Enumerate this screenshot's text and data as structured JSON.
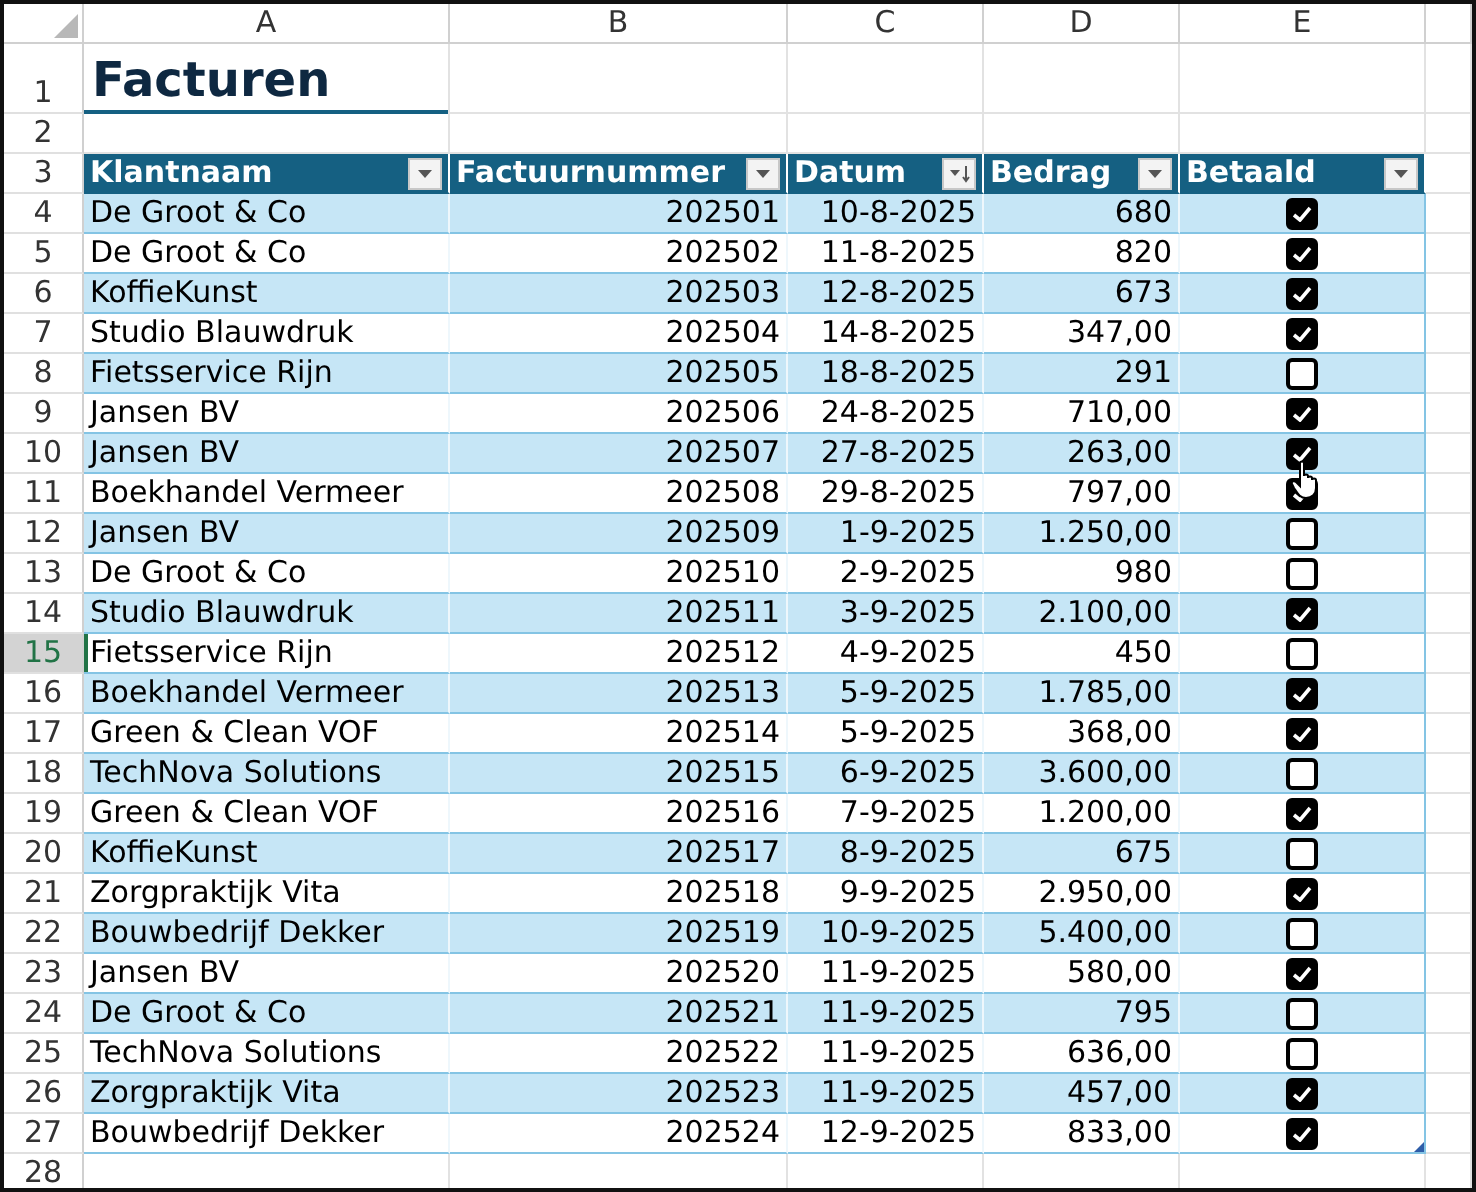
{
  "column_headers": [
    {
      "label": "A",
      "selected": false
    },
    {
      "label": "B",
      "selected": false
    },
    {
      "label": "C",
      "selected": false
    },
    {
      "label": "D",
      "selected": false
    },
    {
      "label": "E",
      "selected": false
    }
  ],
  "row_numbers": [
    {
      "label": "1",
      "selected": false
    },
    {
      "label": "2",
      "selected": false
    },
    {
      "label": "3",
      "selected": false
    },
    {
      "label": "4",
      "selected": false
    },
    {
      "label": "5",
      "selected": false
    },
    {
      "label": "6",
      "selected": false
    },
    {
      "label": "7",
      "selected": false
    },
    {
      "label": "8",
      "selected": false
    },
    {
      "label": "9",
      "selected": false
    },
    {
      "label": "10",
      "selected": false
    },
    {
      "label": "11",
      "selected": false
    },
    {
      "label": "12",
      "selected": false
    },
    {
      "label": "13",
      "selected": false
    },
    {
      "label": "14",
      "selected": false
    },
    {
      "label": "15",
      "selected": true
    },
    {
      "label": "16",
      "selected": false
    },
    {
      "label": "17",
      "selected": false
    },
    {
      "label": "18",
      "selected": false
    },
    {
      "label": "19",
      "selected": false
    },
    {
      "label": "20",
      "selected": false
    },
    {
      "label": "21",
      "selected": false
    },
    {
      "label": "22",
      "selected": false
    },
    {
      "label": "23",
      "selected": false
    },
    {
      "label": "24",
      "selected": false
    },
    {
      "label": "25",
      "selected": false
    },
    {
      "label": "26",
      "selected": false
    },
    {
      "label": "27",
      "selected": false
    },
    {
      "label": "28",
      "selected": false
    }
  ],
  "title": "Facturen",
  "table": {
    "columns": [
      {
        "label": "Klantnaam",
        "sorted": false
      },
      {
        "label": "Factuurnummer",
        "sorted": false
      },
      {
        "label": "Datum",
        "sorted": true
      },
      {
        "label": "Bedrag",
        "sorted": false
      },
      {
        "label": "Betaald",
        "sorted": false
      }
    ],
    "rows": [
      {
        "client": "De Groot & Co",
        "number": "202501",
        "date": "10-8-2025",
        "amount": "680",
        "paid": true
      },
      {
        "client": "De Groot & Co",
        "number": "202502",
        "date": "11-8-2025",
        "amount": "820",
        "paid": true
      },
      {
        "client": "KoffieKunst",
        "number": "202503",
        "date": "12-8-2025",
        "amount": "673",
        "paid": true
      },
      {
        "client": "Studio Blauwdruk",
        "number": "202504",
        "date": "14-8-2025",
        "amount": "347,00",
        "paid": true
      },
      {
        "client": "Fietsservice Rijn",
        "number": "202505",
        "date": "18-8-2025",
        "amount": "291",
        "paid": false
      },
      {
        "client": "Jansen BV",
        "number": "202506",
        "date": "24-8-2025",
        "amount": "710,00",
        "paid": true
      },
      {
        "client": "Jansen BV",
        "number": "202507",
        "date": "27-8-2025",
        "amount": "263,00",
        "paid": true
      },
      {
        "client": "Boekhandel Vermeer",
        "number": "202508",
        "date": "29-8-2025",
        "amount": "797,00",
        "paid": true
      },
      {
        "client": "Jansen BV",
        "number": "202509",
        "date": "1-9-2025",
        "amount": "1.250,00",
        "paid": false
      },
      {
        "client": "De Groot & Co",
        "number": "202510",
        "date": "2-9-2025",
        "amount": "980",
        "paid": false
      },
      {
        "client": "Studio Blauwdruk",
        "number": "202511",
        "date": "3-9-2025",
        "amount": "2.100,00",
        "paid": true
      },
      {
        "client": "Fietsservice Rijn",
        "number": "202512",
        "date": "4-9-2025",
        "amount": "450",
        "paid": false
      },
      {
        "client": "Boekhandel Vermeer",
        "number": "202513",
        "date": "5-9-2025",
        "amount": "1.785,00",
        "paid": true
      },
      {
        "client": "Green & Clean VOF",
        "number": "202514",
        "date": "5-9-2025",
        "amount": "368,00",
        "paid": true
      },
      {
        "client": "TechNova Solutions",
        "number": "202515",
        "date": "6-9-2025",
        "amount": "3.600,00",
        "paid": false
      },
      {
        "client": "Green & Clean VOF",
        "number": "202516",
        "date": "7-9-2025",
        "amount": "1.200,00",
        "paid": true
      },
      {
        "client": "KoffieKunst",
        "number": "202517",
        "date": "8-9-2025",
        "amount": "675",
        "paid": false
      },
      {
        "client": "Zorgpraktijk Vita",
        "number": "202518",
        "date": "9-9-2025",
        "amount": "2.950,00",
        "paid": true
      },
      {
        "client": "Bouwbedrijf Dekker",
        "number": "202519",
        "date": "10-9-2025",
        "amount": "5.400,00",
        "paid": false
      },
      {
        "client": "Jansen BV",
        "number": "202520",
        "date": "11-9-2025",
        "amount": "580,00",
        "paid": true
      },
      {
        "client": "De Groot & Co",
        "number": "202521",
        "date": "11-9-2025",
        "amount": "795",
        "paid": false
      },
      {
        "client": "TechNova Solutions",
        "number": "202522",
        "date": "11-9-2025",
        "amount": "636,00",
        "paid": false
      },
      {
        "client": "Zorgpraktijk Vita",
        "number": "202523",
        "date": "11-9-2025",
        "amount": "457,00",
        "paid": true
      },
      {
        "client": "Bouwbedrijf Dekker",
        "number": "202524",
        "date": "12-9-2025",
        "amount": "833,00",
        "paid": true
      }
    ]
  }
}
